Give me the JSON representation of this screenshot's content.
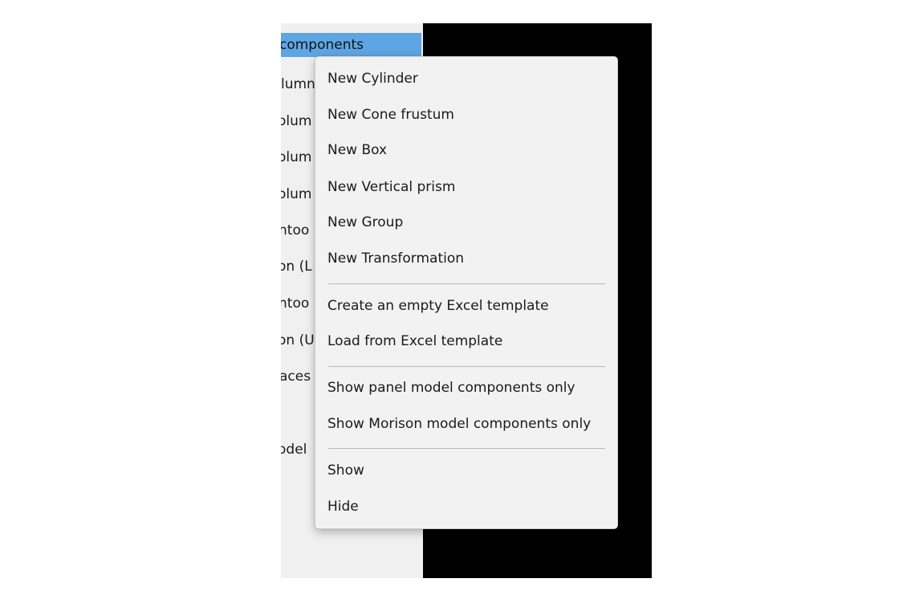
{
  "tree": {
    "items": [
      {
        "label": "components",
        "selected": true
      },
      {
        "label": "lumn"
      },
      {
        "label": "olum"
      },
      {
        "label": "olum"
      },
      {
        "label": "olum"
      },
      {
        "label": "ntoo"
      },
      {
        "label": "on (L"
      },
      {
        "label": "ntoo"
      },
      {
        "label": "on (U"
      },
      {
        "label": "aces"
      },
      {
        "label": "odel"
      }
    ]
  },
  "context_menu": {
    "groups": [
      [
        "New Cylinder",
        "New Cone frustum",
        "New Box",
        "New Vertical prism",
        "New Group",
        "New Transformation"
      ],
      [
        "Create an empty Excel template",
        "Load from Excel template"
      ],
      [
        "Show panel model components only",
        "Show Morison model components only"
      ],
      [
        "Show",
        "Hide"
      ]
    ]
  },
  "colors": {
    "selection": "#5ea6e3",
    "menu_background": "#f2f2f2",
    "panel_background": "#f0f0f0",
    "viewport_background": "#000000"
  }
}
